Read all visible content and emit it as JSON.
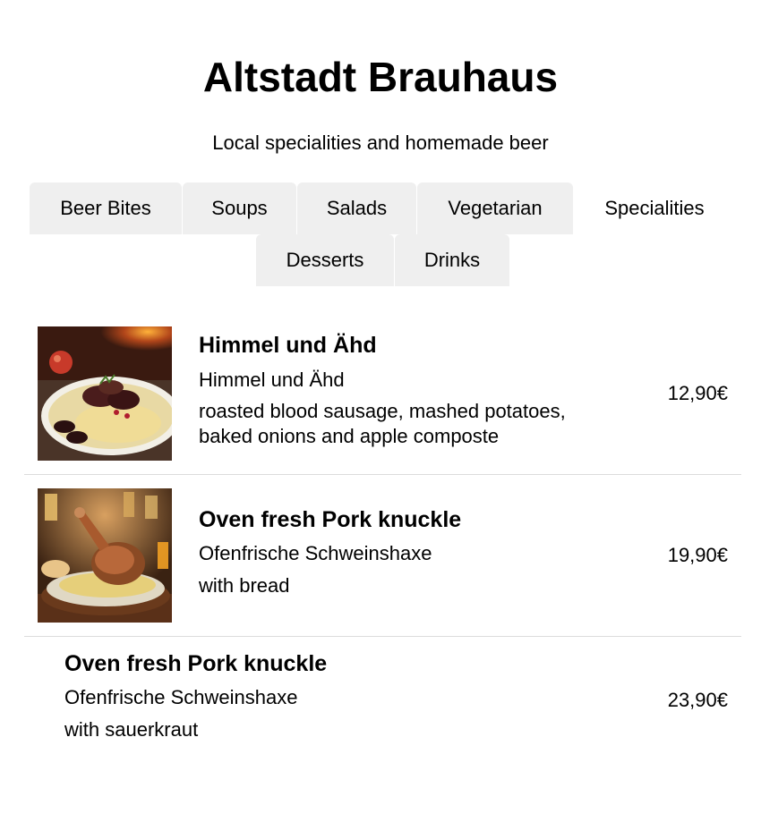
{
  "header": {
    "title": "Altstadt Brauhaus",
    "subtitle": "Local specialities and homemade beer"
  },
  "tabs": [
    {
      "label": "Beer Bites",
      "active": false
    },
    {
      "label": "Soups",
      "active": false
    },
    {
      "label": "Salads",
      "active": false
    },
    {
      "label": "Vegetarian",
      "active": false
    },
    {
      "label": "Specialities",
      "active": true
    },
    {
      "label": "Desserts",
      "active": false
    },
    {
      "label": "Drinks",
      "active": false
    }
  ],
  "menu": {
    "items": [
      {
        "name": "Himmel und Ähd",
        "german_name": "Himmel und Ähd",
        "description": "roasted blood sausage, mashed potatoes, baked onions and apple composte",
        "price": "12,90€",
        "image": "blood-sausage-mashed-potatoes-photo"
      },
      {
        "name": "Oven fresh Pork knuckle",
        "german_name": "Ofenfrische Schweinshaxe",
        "description": "with bread",
        "price": "19,90€",
        "image": "pork-knuckle-photo"
      },
      {
        "name": "Oven fresh Pork knuckle",
        "german_name": "Ofenfrische Schweinshaxe",
        "description": "with sauerkraut",
        "price": "23,90€"
      }
    ]
  },
  "colors": {
    "tab_background": "#efefef",
    "separator": "#dcdcdc",
    "text": "#000000"
  }
}
